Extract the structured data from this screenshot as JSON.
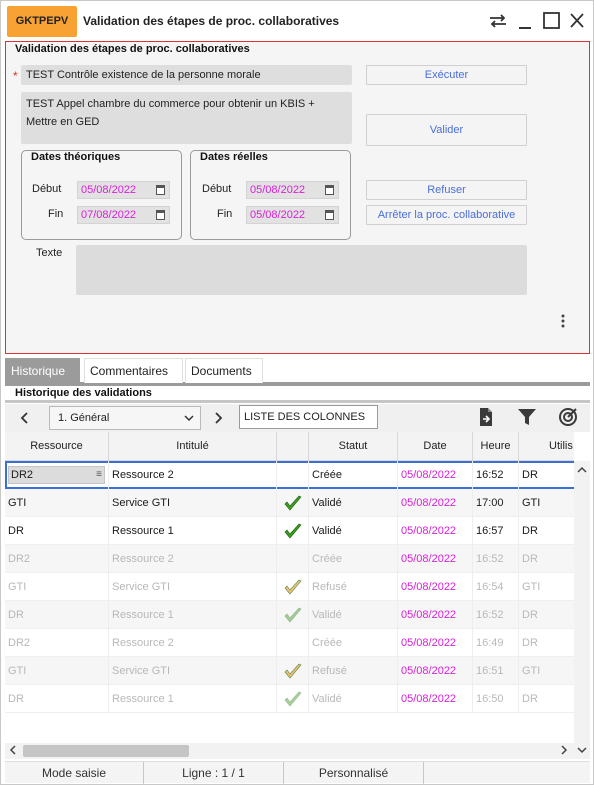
{
  "window": {
    "app_code": "GKTPEPV",
    "title": "Validation des étapes de proc. collaboratives"
  },
  "form": {
    "title": "Validation des étapes de proc. collaboratives",
    "required_mark": "*",
    "field1": "TEST Contrôle existence de la personne morale",
    "field2": "TEST Appel chambre du commerce pour obtenir un KBIS + Mettre en GED",
    "texte_label": "Texte",
    "texte_value": "",
    "dates_theoriques": {
      "legend": "Dates théoriques",
      "debut_label": "Début",
      "debut": "05/08/2022",
      "fin_label": "Fin",
      "fin": "07/08/2022"
    },
    "dates_reelles": {
      "legend": "Dates réelles",
      "debut_label": "Début",
      "debut": "05/08/2022",
      "fin_label": "Fin",
      "fin": "05/08/2022"
    },
    "buttons": {
      "executer": "Exécuter",
      "valider": "Valider",
      "refuser": "Refuser",
      "arreter": "Arrêter la proc. collaborative"
    }
  },
  "tabs": [
    "Historique",
    "Commentaires",
    "Documents"
  ],
  "history": {
    "title": "Historique des validations",
    "view_select": "1. Général",
    "columns_list": "LISTE DES COLONNES",
    "headers": [
      "Ressource",
      "Intitulé",
      "",
      "Statut",
      "Date",
      "Heure",
      "Utilis"
    ],
    "rows": [
      {
        "ressource": "DR2",
        "intitule": "Ressource 2",
        "check": "",
        "statut": "Créée",
        "date": "05/08/2022",
        "heure": "16:52",
        "user": "DR"
      },
      {
        "ressource": "GTI",
        "intitule": "Service GTI",
        "check": "check-green",
        "statut": "Validé",
        "date": "05/08/2022",
        "heure": "17:00",
        "user": "GTI"
      },
      {
        "ressource": "DR",
        "intitule": "Ressource 1",
        "check": "check-green",
        "statut": "Validé",
        "date": "05/08/2022",
        "heure": "16:57",
        "user": "DR"
      },
      {
        "ressource": "DR2",
        "intitule": "Ressource 2",
        "check": "",
        "statut": "Créée",
        "date": "05/08/2022",
        "heure": "16:52",
        "user": "DR"
      },
      {
        "ressource": "GTI",
        "intitule": "Service GTI",
        "check": "check-orange",
        "statut": "Refusé",
        "date": "05/08/2022",
        "heure": "16:54",
        "user": "GTI"
      },
      {
        "ressource": "DR",
        "intitule": "Ressource 1",
        "check": "check-green-faded",
        "statut": "Validé",
        "date": "05/08/2022",
        "heure": "16:52",
        "user": "DR"
      },
      {
        "ressource": "DR2",
        "intitule": "Ressource 2",
        "check": "",
        "statut": "Créée",
        "date": "05/08/2022",
        "heure": "16:49",
        "user": "DR"
      },
      {
        "ressource": "GTI",
        "intitule": "Service GTI",
        "check": "check-orange",
        "statut": "Refusé",
        "date": "05/08/2022",
        "heure": "16:51",
        "user": "GTI"
      },
      {
        "ressource": "DR",
        "intitule": "Ressource 1",
        "check": "check-green-faded",
        "statut": "Validé",
        "date": "05/08/2022",
        "heure": "16:50",
        "user": "DR"
      }
    ]
  },
  "statusbar": {
    "mode": "Mode saisie",
    "ligne": "Ligne : 1 / 1",
    "perso": "Personnalisé"
  },
  "colors": {
    "accent": "#f7a233",
    "date_text": "#d81fd8",
    "button_text": "#4a6fd8",
    "required": "#e03030",
    "check_green": "#3a9e1e",
    "check_orange": "#f0b045"
  }
}
